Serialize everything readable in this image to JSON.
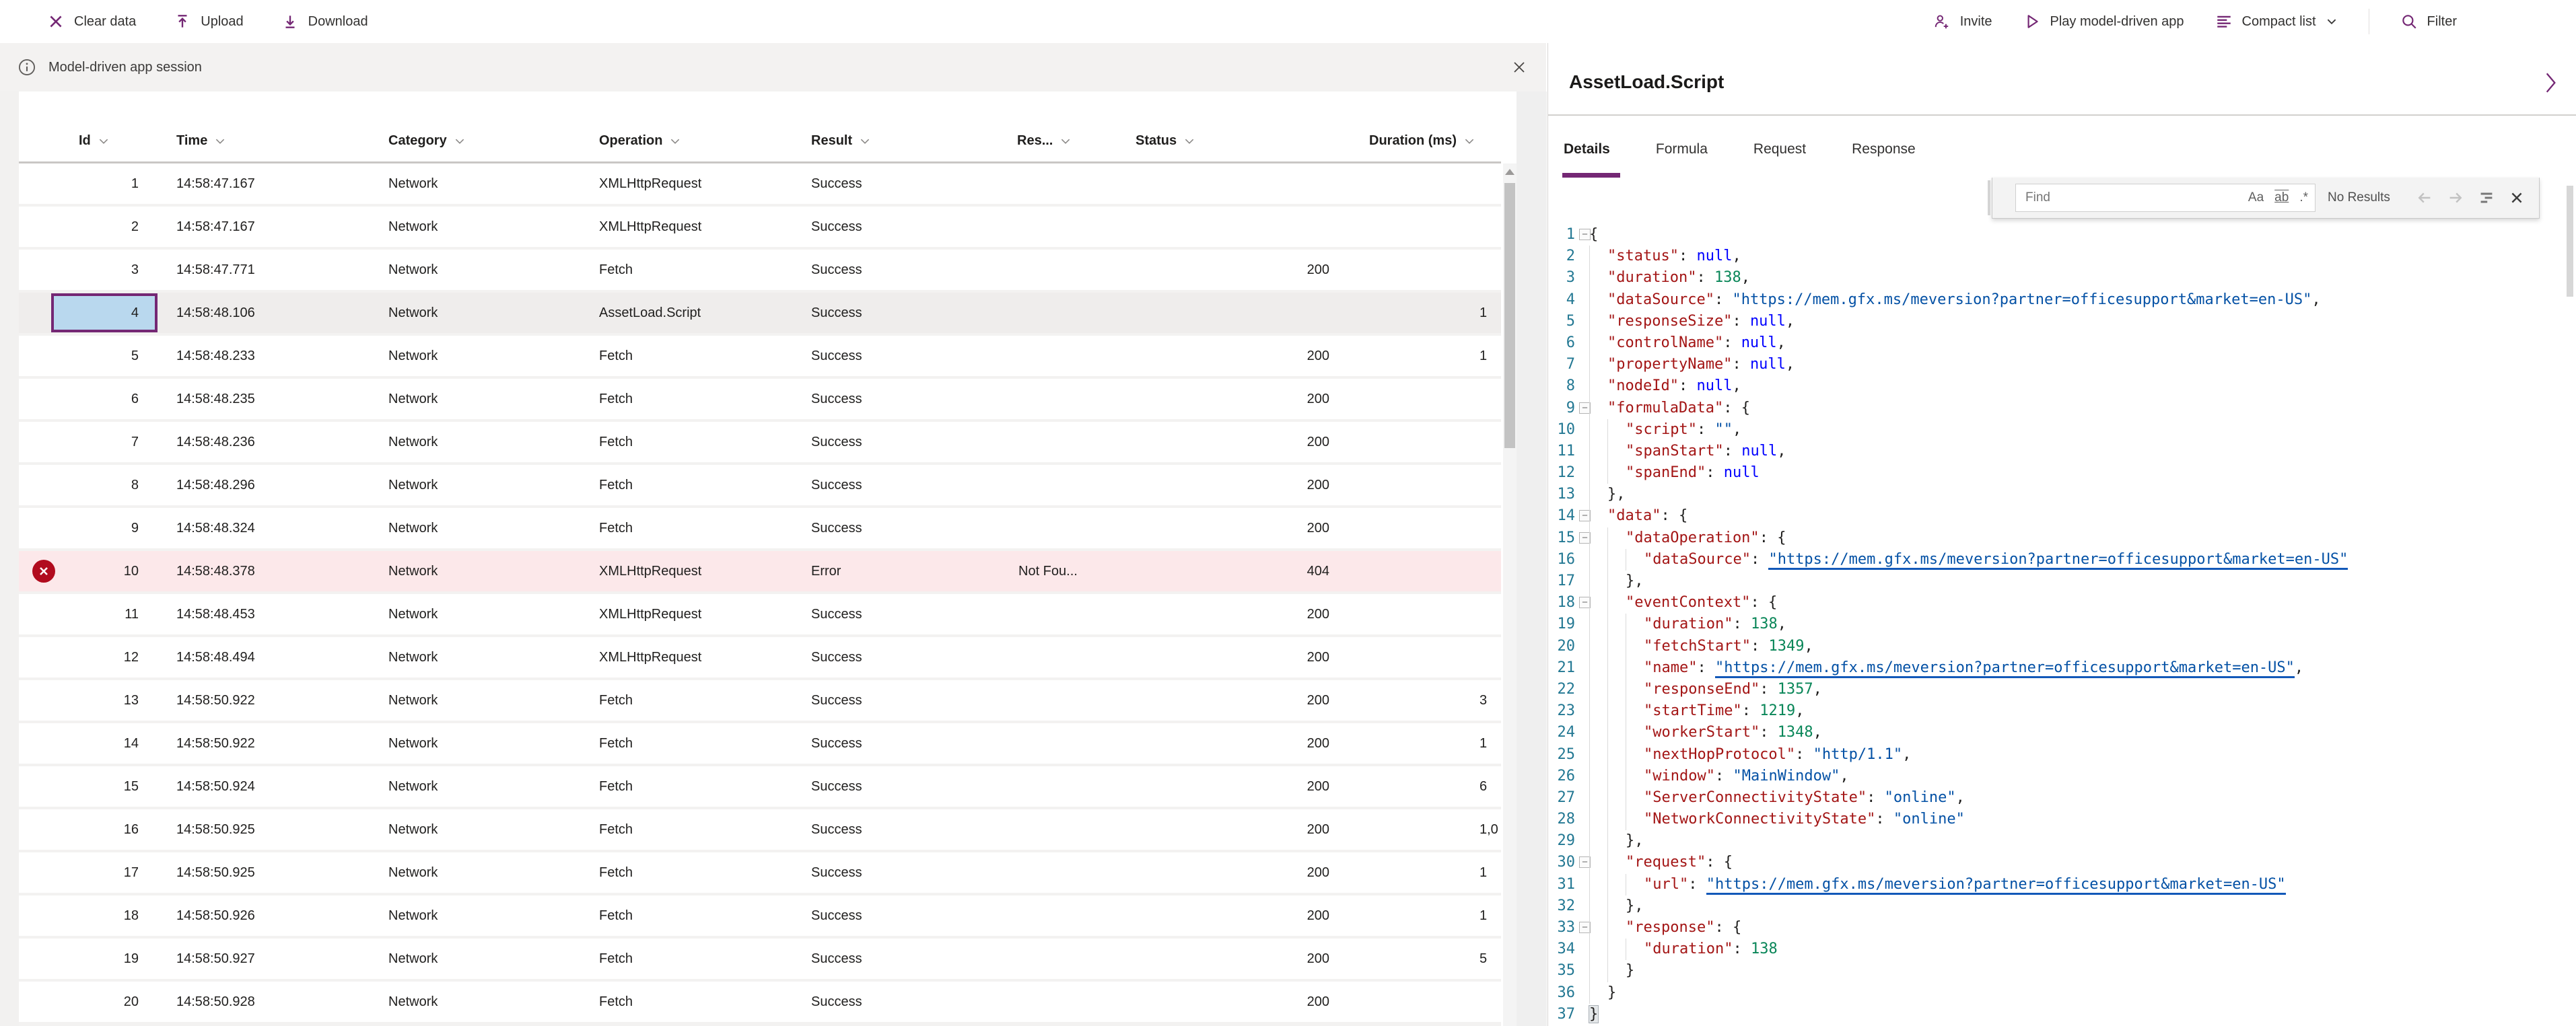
{
  "colors": {
    "accent": "#742774",
    "error_red": "#b10b1e",
    "error_row_bg": "#fce8ea",
    "selected_cell_bg": "#b9d8ee",
    "key": "#a31515",
    "string": "#0451a5",
    "number": "#098658",
    "null": "#0000ff",
    "line_number": "#237893",
    "link": "#1258b8"
  },
  "toolbar": {
    "clear": "Clear data",
    "upload": "Upload",
    "download": "Download",
    "invite": "Invite",
    "play": "Play model-driven app",
    "compact": "Compact list",
    "filter": "Filter"
  },
  "infobar": {
    "message": "Model-driven app session"
  },
  "table": {
    "headers": {
      "id": "Id",
      "time": "Time",
      "category": "Category",
      "operation": "Operation",
      "result": "Result",
      "reason": "Res...",
      "status": "Status",
      "duration": "Duration (ms)"
    },
    "rows": [
      {
        "id": "1",
        "time": "14:58:47.167",
        "category": "Network",
        "operation": "XMLHttpRequest",
        "result": "Success",
        "reason": "",
        "status": "",
        "duration": "",
        "state": ""
      },
      {
        "id": "2",
        "time": "14:58:47.167",
        "category": "Network",
        "operation": "XMLHttpRequest",
        "result": "Success",
        "reason": "",
        "status": "",
        "duration": "",
        "state": ""
      },
      {
        "id": "3",
        "time": "14:58:47.771",
        "category": "Network",
        "operation": "Fetch",
        "result": "Success",
        "reason": "",
        "status": "200",
        "duration": "",
        "state": ""
      },
      {
        "id": "4",
        "time": "14:58:48.106",
        "category": "Network",
        "operation": "AssetLoad.Script",
        "result": "Success",
        "reason": "",
        "status": "",
        "duration": "1",
        "state": "selected"
      },
      {
        "id": "5",
        "time": "14:58:48.233",
        "category": "Network",
        "operation": "Fetch",
        "result": "Success",
        "reason": "",
        "status": "200",
        "duration": "1",
        "state": ""
      },
      {
        "id": "6",
        "time": "14:58:48.235",
        "category": "Network",
        "operation": "Fetch",
        "result": "Success",
        "reason": "",
        "status": "200",
        "duration": "",
        "state": ""
      },
      {
        "id": "7",
        "time": "14:58:48.236",
        "category": "Network",
        "operation": "Fetch",
        "result": "Success",
        "reason": "",
        "status": "200",
        "duration": "",
        "state": ""
      },
      {
        "id": "8",
        "time": "14:58:48.296",
        "category": "Network",
        "operation": "Fetch",
        "result": "Success",
        "reason": "",
        "status": "200",
        "duration": "",
        "state": ""
      },
      {
        "id": "9",
        "time": "14:58:48.324",
        "category": "Network",
        "operation": "Fetch",
        "result": "Success",
        "reason": "",
        "status": "200",
        "duration": "",
        "state": ""
      },
      {
        "id": "10",
        "time": "14:58:48.378",
        "category": "Network",
        "operation": "XMLHttpRequest",
        "result": "Error",
        "reason": "Not Fou...",
        "status": "404",
        "duration": "",
        "state": "error"
      },
      {
        "id": "11",
        "time": "14:58:48.453",
        "category": "Network",
        "operation": "XMLHttpRequest",
        "result": "Success",
        "reason": "",
        "status": "200",
        "duration": "",
        "state": ""
      },
      {
        "id": "12",
        "time": "14:58:48.494",
        "category": "Network",
        "operation": "XMLHttpRequest",
        "result": "Success",
        "reason": "",
        "status": "200",
        "duration": "",
        "state": ""
      },
      {
        "id": "13",
        "time": "14:58:50.922",
        "category": "Network",
        "operation": "Fetch",
        "result": "Success",
        "reason": "",
        "status": "200",
        "duration": "3",
        "state": ""
      },
      {
        "id": "14",
        "time": "14:58:50.922",
        "category": "Network",
        "operation": "Fetch",
        "result": "Success",
        "reason": "",
        "status": "200",
        "duration": "1",
        "state": ""
      },
      {
        "id": "15",
        "time": "14:58:50.924",
        "category": "Network",
        "operation": "Fetch",
        "result": "Success",
        "reason": "",
        "status": "200",
        "duration": "6",
        "state": ""
      },
      {
        "id": "16",
        "time": "14:58:50.925",
        "category": "Network",
        "operation": "Fetch",
        "result": "Success",
        "reason": "",
        "status": "200",
        "duration": "1,0",
        "state": ""
      },
      {
        "id": "17",
        "time": "14:58:50.925",
        "category": "Network",
        "operation": "Fetch",
        "result": "Success",
        "reason": "",
        "status": "200",
        "duration": "1",
        "state": ""
      },
      {
        "id": "18",
        "time": "14:58:50.926",
        "category": "Network",
        "operation": "Fetch",
        "result": "Success",
        "reason": "",
        "status": "200",
        "duration": "1",
        "state": ""
      },
      {
        "id": "19",
        "time": "14:58:50.927",
        "category": "Network",
        "operation": "Fetch",
        "result": "Success",
        "reason": "",
        "status": "200",
        "duration": "5",
        "state": ""
      },
      {
        "id": "20",
        "time": "14:58:50.928",
        "category": "Network",
        "operation": "Fetch",
        "result": "Success",
        "reason": "",
        "status": "200",
        "duration": "",
        "state": ""
      }
    ]
  },
  "panel": {
    "title": "AssetLoad.Script",
    "tabs": [
      "Details",
      "Formula",
      "Request",
      "Response"
    ],
    "active_tab": "Details",
    "find": {
      "placeholder": "Find",
      "match_case": "Aa",
      "whole_word": "ab",
      "regex": ".*",
      "results": "No Results"
    },
    "code": {
      "lines": [
        {
          "n": 1,
          "fold": true,
          "ind": 0,
          "seg": [
            [
              "{",
              "p"
            ]
          ]
        },
        {
          "n": 2,
          "ind": 1,
          "seg": [
            [
              "\"status\"",
              "k"
            ],
            [
              ": ",
              "p"
            ],
            [
              "null",
              "u"
            ],
            [
              ",",
              "p"
            ]
          ]
        },
        {
          "n": 3,
          "ind": 1,
          "seg": [
            [
              "\"duration\"",
              "k"
            ],
            [
              ": ",
              "p"
            ],
            [
              "138",
              "n"
            ],
            [
              ",",
              "p"
            ]
          ]
        },
        {
          "n": 4,
          "ind": 1,
          "seg": [
            [
              "\"dataSource\"",
              "k"
            ],
            [
              ": ",
              "p"
            ],
            [
              "\"https://mem.gfx.ms/meversion?partner=officesupport&market=en-US\"",
              "s"
            ],
            [
              ",",
              "p"
            ]
          ]
        },
        {
          "n": 5,
          "ind": 1,
          "seg": [
            [
              "\"responseSize\"",
              "k"
            ],
            [
              ": ",
              "p"
            ],
            [
              "null",
              "u"
            ],
            [
              ",",
              "p"
            ]
          ]
        },
        {
          "n": 6,
          "ind": 1,
          "seg": [
            [
              "\"controlName\"",
              "k"
            ],
            [
              ": ",
              "p"
            ],
            [
              "null",
              "u"
            ],
            [
              ",",
              "p"
            ]
          ]
        },
        {
          "n": 7,
          "ind": 1,
          "seg": [
            [
              "\"propertyName\"",
              "k"
            ],
            [
              ": ",
              "p"
            ],
            [
              "null",
              "u"
            ],
            [
              ",",
              "p"
            ]
          ]
        },
        {
          "n": 8,
          "ind": 1,
          "seg": [
            [
              "\"nodeId\"",
              "k"
            ],
            [
              ": ",
              "p"
            ],
            [
              "null",
              "u"
            ],
            [
              ",",
              "p"
            ]
          ]
        },
        {
          "n": 9,
          "fold": true,
          "ind": 1,
          "seg": [
            [
              "\"formulaData\"",
              "k"
            ],
            [
              ": ",
              "p"
            ],
            [
              "{",
              "p"
            ]
          ]
        },
        {
          "n": 10,
          "ind": 2,
          "seg": [
            [
              "\"script\"",
              "k"
            ],
            [
              ": ",
              "p"
            ],
            [
              "\"\"",
              "s"
            ],
            [
              ",",
              "p"
            ]
          ]
        },
        {
          "n": 11,
          "ind": 2,
          "seg": [
            [
              "\"spanStart\"",
              "k"
            ],
            [
              ": ",
              "p"
            ],
            [
              "null",
              "u"
            ],
            [
              ",",
              "p"
            ]
          ]
        },
        {
          "n": 12,
          "ind": 2,
          "seg": [
            [
              "\"spanEnd\"",
              "k"
            ],
            [
              ": ",
              "p"
            ],
            [
              "null",
              "u"
            ]
          ]
        },
        {
          "n": 13,
          "ind": 1,
          "seg": [
            [
              "},",
              "p"
            ]
          ]
        },
        {
          "n": 14,
          "fold": true,
          "ind": 1,
          "seg": [
            [
              "\"data\"",
              "k"
            ],
            [
              ": ",
              "p"
            ],
            [
              "{",
              "p"
            ]
          ]
        },
        {
          "n": 15,
          "fold": true,
          "ind": 2,
          "seg": [
            [
              "\"dataOperation\"",
              "k"
            ],
            [
              ": ",
              "p"
            ],
            [
              "{",
              "p"
            ]
          ]
        },
        {
          "n": 16,
          "ind": 3,
          "seg": [
            [
              "\"dataSource\"",
              "k"
            ],
            [
              ": ",
              "p"
            ],
            [
              "\"https://mem.gfx.ms/meversion?partner=officesupport&market=en-US\"",
              "l"
            ]
          ]
        },
        {
          "n": 17,
          "ind": 2,
          "seg": [
            [
              "},",
              "p"
            ]
          ]
        },
        {
          "n": 18,
          "fold": true,
          "ind": 2,
          "seg": [
            [
              "\"eventContext\"",
              "k"
            ],
            [
              ": ",
              "p"
            ],
            [
              "{",
              "p"
            ]
          ]
        },
        {
          "n": 19,
          "ind": 3,
          "seg": [
            [
              "\"duration\"",
              "k"
            ],
            [
              ": ",
              "p"
            ],
            [
              "138",
              "n"
            ],
            [
              ",",
              "p"
            ]
          ]
        },
        {
          "n": 20,
          "ind": 3,
          "seg": [
            [
              "\"fetchStart\"",
              "k"
            ],
            [
              ": ",
              "p"
            ],
            [
              "1349",
              "n"
            ],
            [
              ",",
              "p"
            ]
          ]
        },
        {
          "n": 21,
          "ind": 3,
          "seg": [
            [
              "\"name\"",
              "k"
            ],
            [
              ": ",
              "p"
            ],
            [
              "\"https://mem.gfx.ms/meversion?partner=officesupport&market=en-US\"",
              "l"
            ],
            [
              ",",
              "p"
            ]
          ]
        },
        {
          "n": 22,
          "ind": 3,
          "seg": [
            [
              "\"responseEnd\"",
              "k"
            ],
            [
              ": ",
              "p"
            ],
            [
              "1357",
              "n"
            ],
            [
              ",",
              "p"
            ]
          ]
        },
        {
          "n": 23,
          "ind": 3,
          "seg": [
            [
              "\"startTime\"",
              "k"
            ],
            [
              ": ",
              "p"
            ],
            [
              "1219",
              "n"
            ],
            [
              ",",
              "p"
            ]
          ]
        },
        {
          "n": 24,
          "ind": 3,
          "seg": [
            [
              "\"workerStart\"",
              "k"
            ],
            [
              ": ",
              "p"
            ],
            [
              "1348",
              "n"
            ],
            [
              ",",
              "p"
            ]
          ]
        },
        {
          "n": 25,
          "ind": 3,
          "seg": [
            [
              "\"nextHopProtocol\"",
              "k"
            ],
            [
              ": ",
              "p"
            ],
            [
              "\"http/1.1\"",
              "s"
            ],
            [
              ",",
              "p"
            ]
          ]
        },
        {
          "n": 26,
          "ind": 3,
          "seg": [
            [
              "\"window\"",
              "k"
            ],
            [
              ": ",
              "p"
            ],
            [
              "\"MainWindow\"",
              "s"
            ],
            [
              ",",
              "p"
            ]
          ]
        },
        {
          "n": 27,
          "ind": 3,
          "seg": [
            [
              "\"ServerConnectivityState\"",
              "k"
            ],
            [
              ": ",
              "p"
            ],
            [
              "\"online\"",
              "s"
            ],
            [
              ",",
              "p"
            ]
          ]
        },
        {
          "n": 28,
          "ind": 3,
          "seg": [
            [
              "\"NetworkConnectivityState\"",
              "k"
            ],
            [
              ": ",
              "p"
            ],
            [
              "\"online\"",
              "s"
            ]
          ]
        },
        {
          "n": 29,
          "ind": 2,
          "seg": [
            [
              "},",
              "p"
            ]
          ]
        },
        {
          "n": 30,
          "fold": true,
          "ind": 2,
          "seg": [
            [
              "\"request\"",
              "k"
            ],
            [
              ": ",
              "p"
            ],
            [
              "{",
              "p"
            ]
          ]
        },
        {
          "n": 31,
          "ind": 3,
          "seg": [
            [
              "\"url\"",
              "k"
            ],
            [
              ": ",
              "p"
            ],
            [
              "\"https://mem.gfx.ms/meversion?partner=officesupport&market=en-US\"",
              "l"
            ]
          ]
        },
        {
          "n": 32,
          "ind": 2,
          "seg": [
            [
              "},",
              "p"
            ]
          ]
        },
        {
          "n": 33,
          "fold": true,
          "ind": 2,
          "seg": [
            [
              "\"response\"",
              "k"
            ],
            [
              ": ",
              "p"
            ],
            [
              "{",
              "p"
            ]
          ]
        },
        {
          "n": 34,
          "ind": 3,
          "seg": [
            [
              "\"duration\"",
              "k"
            ],
            [
              ": ",
              "p"
            ],
            [
              "138",
              "n"
            ]
          ]
        },
        {
          "n": 35,
          "ind": 2,
          "seg": [
            [
              "}",
              "p"
            ]
          ]
        },
        {
          "n": 36,
          "ind": 1,
          "seg": [
            [
              "}",
              "p"
            ]
          ]
        },
        {
          "n": 37,
          "ind": 0,
          "seg": [
            [
              "}",
              "pm"
            ]
          ]
        }
      ]
    }
  }
}
